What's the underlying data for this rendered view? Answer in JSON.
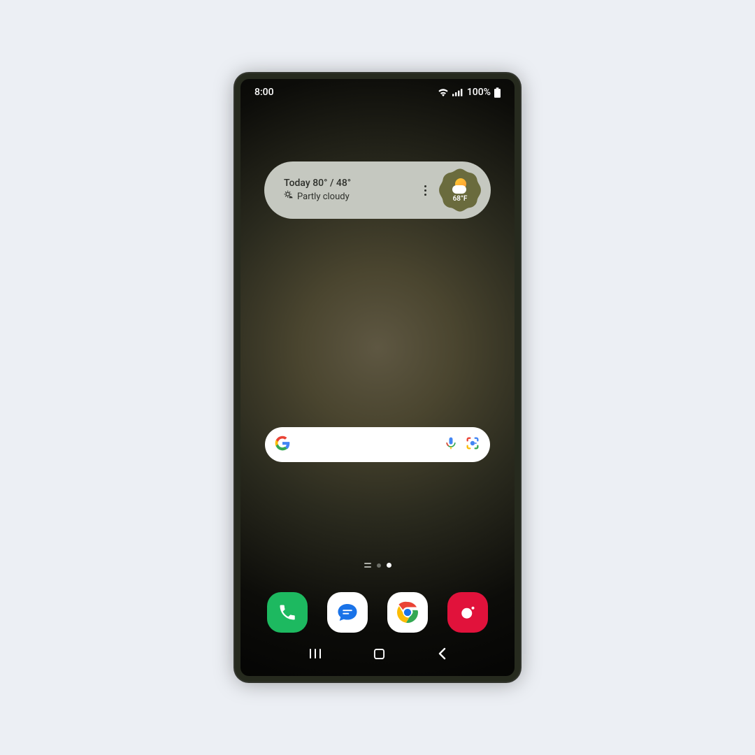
{
  "status": {
    "time": "8:00",
    "battery_text": "100%"
  },
  "weather": {
    "today_label": "Today 80° / 48°",
    "condition": "Partly cloudy",
    "badge_temp": "68°F"
  },
  "search": {
    "placeholder": ""
  },
  "dock": {
    "apps": [
      "phone",
      "messages",
      "chrome",
      "camera"
    ]
  }
}
